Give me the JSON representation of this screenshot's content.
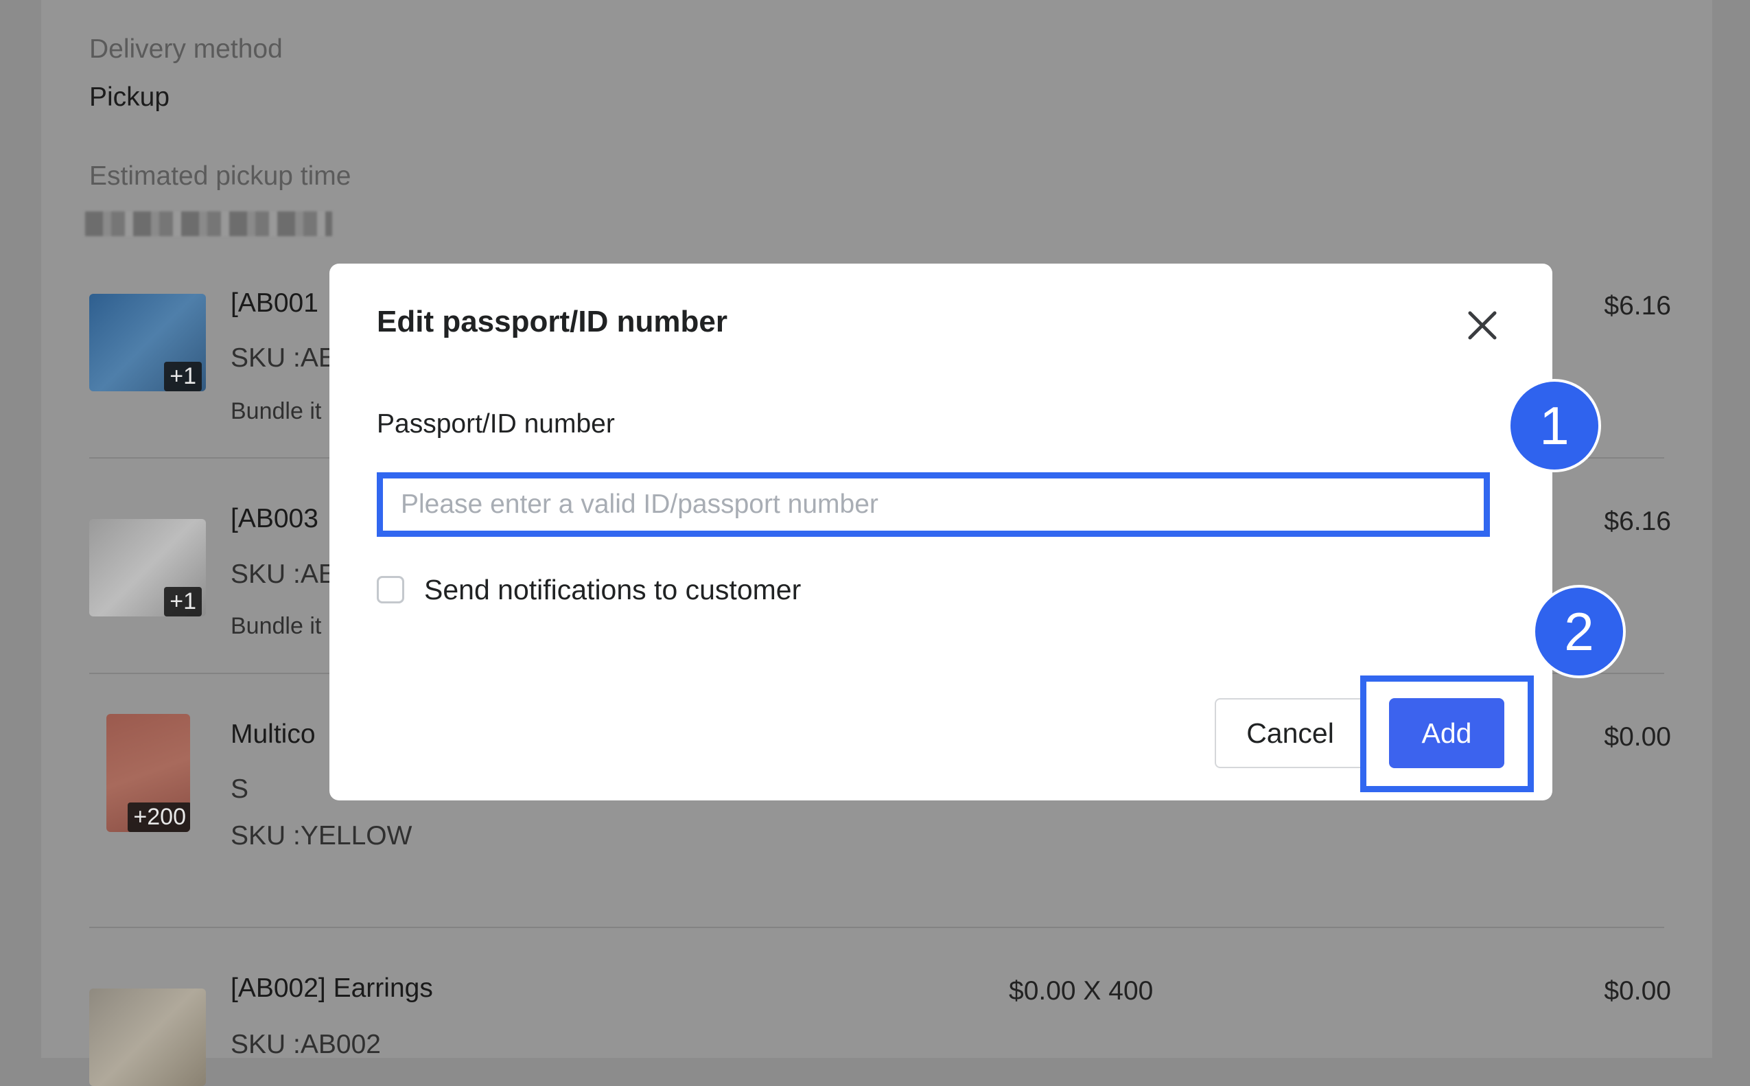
{
  "background": {
    "delivery_method_label": "Delivery method",
    "delivery_method_value": "Pickup",
    "pickup_time_label": "Estimated pickup time",
    "items": [
      {
        "title": "[AB001",
        "sku": "SKU :AE",
        "sub": "Bundle it",
        "badge": "+1",
        "qty": "",
        "price": "$6.16"
      },
      {
        "title": "[AB003",
        "sku": "SKU :AE",
        "sub": "Bundle it",
        "badge": "+1",
        "qty": "",
        "price": "$6.16"
      },
      {
        "title": "Multico",
        "variant": "S",
        "sku": "SKU :YELLOW",
        "badge": "+200",
        "qty": "",
        "price": "$0.00"
      },
      {
        "title": "[AB002] Earrings",
        "sku": "SKU :AB002",
        "badge": "",
        "qty": "$0.00 X 400",
        "price": "$0.00"
      }
    ]
  },
  "modal": {
    "title": "Edit passport/ID number",
    "field_label": "Passport/ID number",
    "input_placeholder": "Please enter a valid ID/passport number",
    "input_value": "",
    "checkbox_label": "Send notifications to customer",
    "checkbox_checked": false,
    "cancel_label": "Cancel",
    "add_label": "Add",
    "close_icon": "close-icon"
  },
  "annotations": {
    "step1": "1",
    "step2": "2"
  },
  "colors": {
    "accent": "#3c63ee",
    "highlight": "#3167f0",
    "overlay": "#8c8c8c"
  }
}
